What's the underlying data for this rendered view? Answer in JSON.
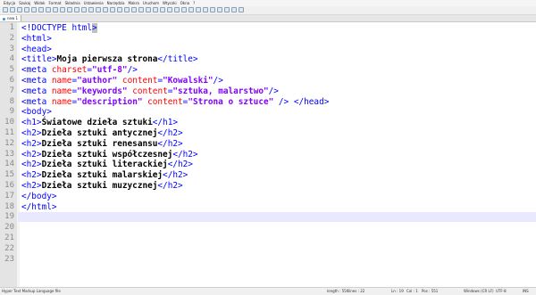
{
  "menu": [
    "Edycja",
    "Szukaj",
    "Widok",
    "Format",
    "Składnia",
    "Ustawienia",
    "Narzędzia",
    "Makra",
    "Uruchom",
    "Wtyczki",
    "Okna",
    "?"
  ],
  "tab": {
    "label": "new 1"
  },
  "lines": [
    {
      "n": "1",
      "segs": [
        {
          "t": "<!",
          "c": "tag"
        },
        {
          "t": "DOCTYPE html",
          "c": "decl"
        },
        {
          "t": ">",
          "c": "tag sel"
        }
      ]
    },
    {
      "n": "2",
      "segs": [
        {
          "t": "<html>",
          "c": "tag"
        }
      ]
    },
    {
      "n": "3",
      "segs": [
        {
          "t": "<head>",
          "c": "tag"
        }
      ]
    },
    {
      "n": "4",
      "segs": [
        {
          "t": "<title>",
          "c": "tag"
        },
        {
          "t": "Moja pierwsza strona",
          "c": "txt"
        },
        {
          "t": "</title>",
          "c": "tag"
        }
      ]
    },
    {
      "n": "5",
      "segs": [
        {
          "t": "<meta ",
          "c": "tag"
        },
        {
          "t": "charset",
          "c": "attr"
        },
        {
          "t": "=",
          "c": "tag"
        },
        {
          "t": "\"utf-8\"",
          "c": "val"
        },
        {
          "t": "/>",
          "c": "tag"
        }
      ]
    },
    {
      "n": "6",
      "segs": [
        {
          "t": "<meta ",
          "c": "tag"
        },
        {
          "t": "name",
          "c": "attr"
        },
        {
          "t": "=",
          "c": "tag"
        },
        {
          "t": "\"author\"",
          "c": "val"
        },
        {
          "t": " ",
          "c": "tag"
        },
        {
          "t": "content",
          "c": "attr"
        },
        {
          "t": "=",
          "c": "tag"
        },
        {
          "t": "\"Kowalski\"",
          "c": "val"
        },
        {
          "t": "/>",
          "c": "tag"
        }
      ]
    },
    {
      "n": "7",
      "segs": [
        {
          "t": "<meta ",
          "c": "tag"
        },
        {
          "t": "name",
          "c": "attr"
        },
        {
          "t": "=",
          "c": "tag"
        },
        {
          "t": "\"keywords\"",
          "c": "val"
        },
        {
          "t": " ",
          "c": "tag"
        },
        {
          "t": "content",
          "c": "attr"
        },
        {
          "t": "=",
          "c": "tag"
        },
        {
          "t": "\"sztuka, malarstwo\"",
          "c": "val"
        },
        {
          "t": "/>",
          "c": "tag"
        }
      ]
    },
    {
      "n": "8",
      "segs": [
        {
          "t": "<meta ",
          "c": "tag"
        },
        {
          "t": "name",
          "c": "attr"
        },
        {
          "t": "=",
          "c": "tag"
        },
        {
          "t": "\"description\"",
          "c": "val"
        },
        {
          "t": " ",
          "c": "tag"
        },
        {
          "t": "content",
          "c": "attr"
        },
        {
          "t": "=",
          "c": "tag"
        },
        {
          "t": "\"Strona o sztuce\"",
          "c": "val"
        },
        {
          "t": " /> </head>",
          "c": "tag"
        }
      ]
    },
    {
      "n": "9",
      "segs": [
        {
          "t": "<body>",
          "c": "tag"
        }
      ]
    },
    {
      "n": "10",
      "segs": [
        {
          "t": "<h1>",
          "c": "tag"
        },
        {
          "t": "Światowe dzieła sztuki",
          "c": "txt"
        },
        {
          "t": "</h1>",
          "c": "tag"
        }
      ]
    },
    {
      "n": "11",
      "segs": [
        {
          "t": "<h2>",
          "c": "tag"
        },
        {
          "t": "Dzieła sztuki antycznej",
          "c": "txt"
        },
        {
          "t": "</h2>",
          "c": "tag"
        }
      ]
    },
    {
      "n": "12",
      "segs": [
        {
          "t": "<h2>",
          "c": "tag"
        },
        {
          "t": "Dzieła sztuki renesansu",
          "c": "txt"
        },
        {
          "t": "</h2>",
          "c": "tag"
        }
      ]
    },
    {
      "n": "13",
      "segs": [
        {
          "t": "<h2>",
          "c": "tag"
        },
        {
          "t": "Dzieła sztuki współczesnej",
          "c": "txt"
        },
        {
          "t": "</h2>",
          "c": "tag"
        }
      ]
    },
    {
      "n": "14",
      "segs": [
        {
          "t": "<h2>",
          "c": "tag"
        },
        {
          "t": "Dzieła sztuki literackiej",
          "c": "txt"
        },
        {
          "t": "</h2>",
          "c": "tag"
        }
      ]
    },
    {
      "n": "15",
      "segs": [
        {
          "t": "<h2>",
          "c": "tag"
        },
        {
          "t": "Dzieła sztuki malarskiej",
          "c": "txt"
        },
        {
          "t": "</h2>",
          "c": "tag"
        }
      ]
    },
    {
      "n": "16",
      "segs": [
        {
          "t": "<h2>",
          "c": "tag"
        },
        {
          "t": "Dzieła sztuki muzycznej",
          "c": "txt"
        },
        {
          "t": "</h2>",
          "c": "tag"
        }
      ]
    },
    {
      "n": "17",
      "segs": [
        {
          "t": "</body>",
          "c": "tag"
        }
      ]
    },
    {
      "n": "18",
      "segs": [
        {
          "t": "</html>",
          "c": "tag"
        }
      ]
    },
    {
      "n": "19",
      "segs": []
    },
    {
      "n": "20",
      "segs": []
    },
    {
      "n": "21",
      "segs": []
    },
    {
      "n": "22",
      "segs": []
    },
    {
      "n": "23",
      "segs": []
    }
  ],
  "active_line": "19",
  "status": {
    "file_type": "Hyper Text Markup Language file",
    "length": "length : 556",
    "lines": "lines : 22",
    "ln": "Ln : 19",
    "col": "Col : 1",
    "pos": "Pos : 551",
    "eol": "Windows (CR LF)",
    "encoding": "UTF-8",
    "mode": "INS"
  }
}
